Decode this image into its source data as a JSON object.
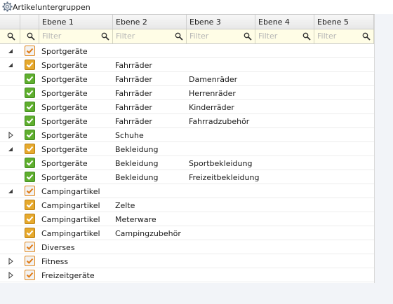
{
  "window": {
    "title": "Artikeluntergruppen",
    "icon": "gear-icon"
  },
  "columns": [
    {
      "label": ""
    },
    {
      "label": ""
    },
    {
      "label": "Ebene 1"
    },
    {
      "label": "Ebene 2"
    },
    {
      "label": "Ebene 3"
    },
    {
      "label": "Ebene 4"
    },
    {
      "label": "Ebene 5"
    }
  ],
  "filter": {
    "placeholder": "Filter"
  },
  "colors": {
    "check_green": "#5fae2e",
    "check_orange_border": "#e0861a",
    "check_yellow": "#e6a92d",
    "filter_bg": "#fffde6"
  },
  "rows": [
    {
      "toggle": "expanded",
      "check": "orange",
      "e1": "Sportgeräte",
      "e2": "",
      "e3": ""
    },
    {
      "toggle": "expanded",
      "check": "yellow",
      "e1": "Sportgeräte",
      "e2": "Fahrräder",
      "e3": ""
    },
    {
      "toggle": "none",
      "check": "green",
      "e1": "Sportgeräte",
      "e2": "Fahrräder",
      "e3": "Damenräder"
    },
    {
      "toggle": "none",
      "check": "green",
      "e1": "Sportgeräte",
      "e2": "Fahrräder",
      "e3": "Herrenräder"
    },
    {
      "toggle": "none",
      "check": "green",
      "e1": "Sportgeräte",
      "e2": "Fahrräder",
      "e3": "Kinderräder"
    },
    {
      "toggle": "none",
      "check": "green",
      "e1": "Sportgeräte",
      "e2": "Fahrräder",
      "e3": "Fahrradzubehör"
    },
    {
      "toggle": "collapsed",
      "check": "green",
      "e1": "Sportgeräte",
      "e2": "Schuhe",
      "e3": ""
    },
    {
      "toggle": "expanded",
      "check": "yellow",
      "e1": "Sportgeräte",
      "e2": "Bekleidung",
      "e3": ""
    },
    {
      "toggle": "none",
      "check": "green",
      "e1": "Sportgeräte",
      "e2": "Bekleidung",
      "e3": "Sportbekleidung"
    },
    {
      "toggle": "none",
      "check": "green",
      "e1": "Sportgeräte",
      "e2": "Bekleidung",
      "e3": "Freizeitbekleidung"
    },
    {
      "toggle": "expanded",
      "check": "orange",
      "e1": "Campingartikel",
      "e2": "",
      "e3": ""
    },
    {
      "toggle": "none",
      "check": "yellow",
      "e1": "Campingartikel",
      "e2": "Zelte",
      "e3": ""
    },
    {
      "toggle": "none",
      "check": "yellow",
      "e1": "Campingartikel",
      "e2": "Meterware",
      "e3": ""
    },
    {
      "toggle": "none",
      "check": "yellow",
      "e1": "Campingartikel",
      "e2": "Campingzubehör",
      "e3": ""
    },
    {
      "toggle": "none",
      "check": "orange",
      "e1": "Diverses",
      "e2": "",
      "e3": ""
    },
    {
      "toggle": "collapsed",
      "check": "orange",
      "e1": "Fitness",
      "e2": "",
      "e3": ""
    },
    {
      "toggle": "collapsed",
      "check": "orange",
      "e1": "Freizeitgeräte",
      "e2": "",
      "e3": ""
    }
  ]
}
